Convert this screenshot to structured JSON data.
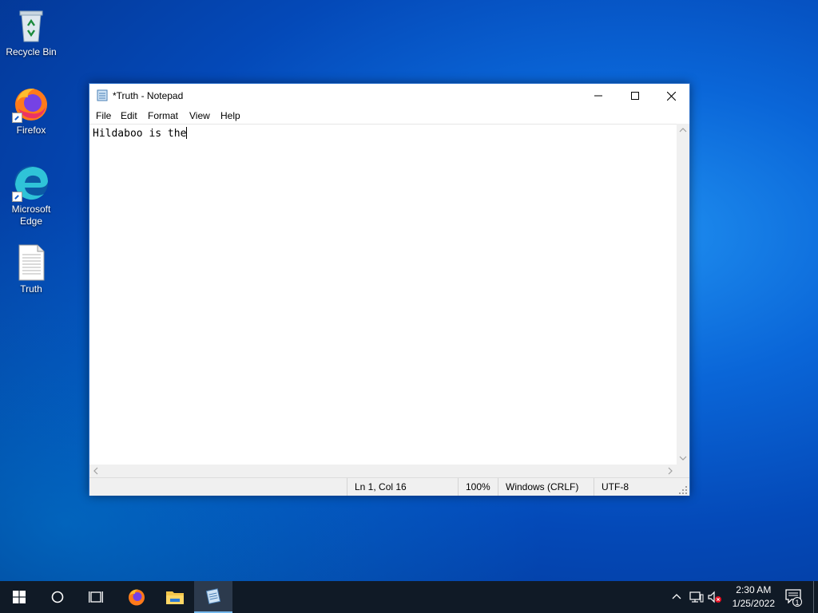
{
  "desktop": {
    "icons": [
      {
        "label": "Recycle Bin"
      },
      {
        "label": "Firefox"
      },
      {
        "label": "Microsoft Edge"
      },
      {
        "label": "Truth"
      }
    ]
  },
  "notepad": {
    "title": "*Truth - Notepad",
    "menu": [
      "File",
      "Edit",
      "Format",
      "View",
      "Help"
    ],
    "content": "Hildaboo is the",
    "status": {
      "position": "Ln 1, Col 16",
      "zoom": "100%",
      "line_ending": "Windows (CRLF)",
      "encoding": "UTF-8"
    }
  },
  "taskbar": {
    "time": "2:30 AM",
    "date": "1/25/2022",
    "notification_count": "1"
  },
  "colors": {
    "taskbar": "#101a26",
    "window_border": "#2b6fc9",
    "desktop_accent": "#0a66d8"
  }
}
